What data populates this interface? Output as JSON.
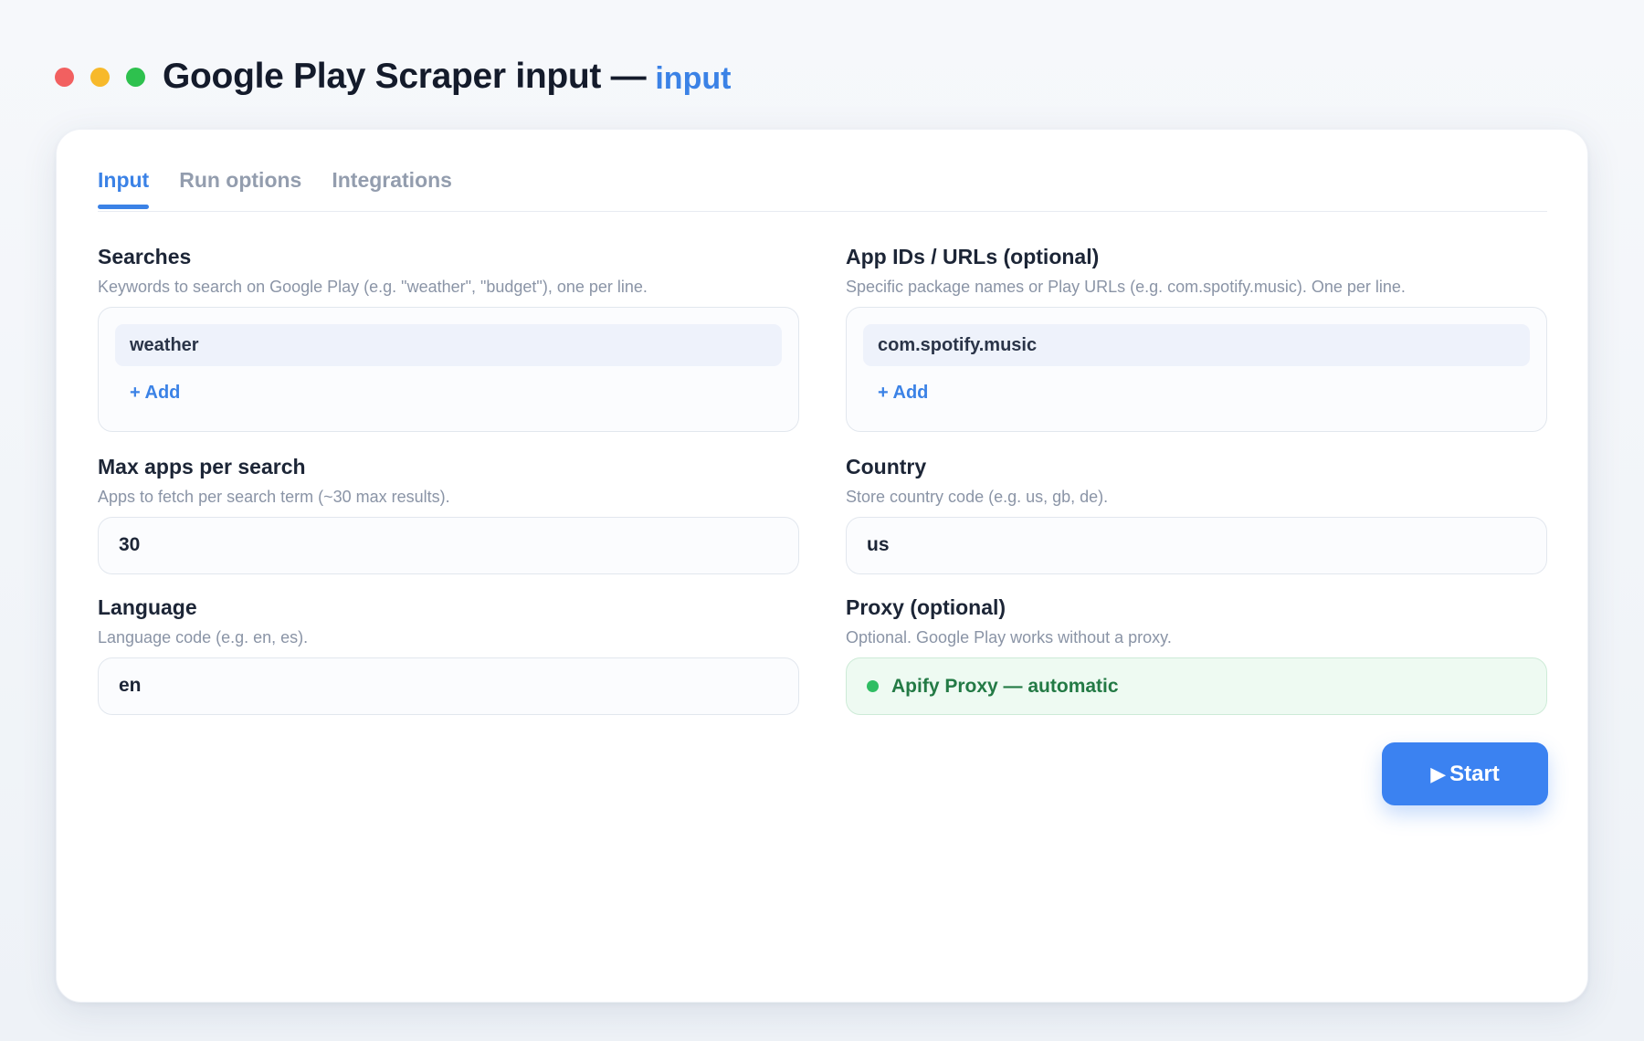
{
  "window": {
    "title": "Google Play Scraper input —",
    "title_accent": "input"
  },
  "tabs": [
    {
      "label": "Input",
      "active": true
    },
    {
      "label": "Run options",
      "active": false
    },
    {
      "label": "Integrations",
      "active": false
    }
  ],
  "searches": {
    "label": "Searches",
    "description": "Keywords to search on Google Play (e.g. \"weather\", \"budget\"), one per line.",
    "items": [
      "weather"
    ],
    "add_label": "+ Add"
  },
  "app_ids": {
    "label": "App IDs / URLs (optional)",
    "description": "Specific package names or Play URLs (e.g. com.spotify.music). One per line.",
    "items": [
      "com.spotify.music"
    ],
    "add_label": "+ Add"
  },
  "max_apps": {
    "label": "Max apps per search",
    "description": "Apps to fetch per search term (~30 max results).",
    "value": "30"
  },
  "country": {
    "label": "Country",
    "description": "Store country code (e.g. us, gb, de).",
    "value": "us"
  },
  "language": {
    "label": "Language",
    "description": "Language code (e.g. en, es).",
    "value": "en"
  },
  "proxy": {
    "label": "Proxy (optional)",
    "description": "Optional. Google Play works without a proxy.",
    "value": "Apify Proxy — automatic",
    "status_color": "#2fbd63"
  },
  "start_button": {
    "icon": "play-icon",
    "glyph": "▶",
    "label": "Start"
  },
  "colors": {
    "accent": "#3b82e6",
    "close": "#f26060",
    "minimize": "#f7b92b",
    "maximize": "#2ec14e"
  }
}
